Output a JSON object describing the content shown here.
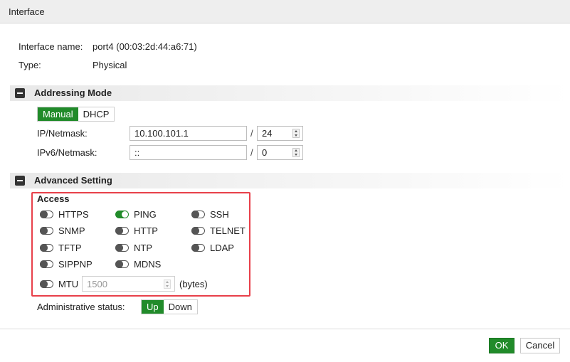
{
  "header": {
    "title": "Interface"
  },
  "info": {
    "interface_name_label": "Interface name:",
    "interface_name_value": "port4 (00:03:2d:44:a6:71)",
    "type_label": "Type:",
    "type_value": "Physical"
  },
  "addressing": {
    "section_title": "Addressing Mode",
    "mode_options": [
      "Manual",
      "DHCP"
    ],
    "selected_mode": "Manual",
    "ip_label": "IP/Netmask:",
    "ip_value": "10.100.101.1",
    "netmask_value": "24",
    "ipv6_label": "IPv6/Netmask:",
    "ipv6_value": "::",
    "ipv6_netmask_value": "0",
    "separator": "/"
  },
  "advanced": {
    "section_title": "Advanced Setting",
    "access_title": "Access",
    "access": [
      {
        "label": "HTTPS",
        "enabled": false
      },
      {
        "label": "PING",
        "enabled": true
      },
      {
        "label": "SSH",
        "enabled": false
      },
      {
        "label": "SNMP",
        "enabled": false
      },
      {
        "label": "HTTP",
        "enabled": false
      },
      {
        "label": "TELNET",
        "enabled": false
      },
      {
        "label": "TFTP",
        "enabled": false
      },
      {
        "label": "NTP",
        "enabled": false
      },
      {
        "label": "LDAP",
        "enabled": false
      },
      {
        "label": "SIPPNP",
        "enabled": false
      },
      {
        "label": "MDNS",
        "enabled": false
      }
    ],
    "mtu": {
      "label": "MTU",
      "enabled": false,
      "value": "1500",
      "unit": "(bytes)"
    },
    "admin_status_label": "Administrative status:",
    "admin_status_options": [
      "Up",
      "Down"
    ],
    "admin_status_selected": "Up"
  },
  "footer": {
    "ok_label": "OK",
    "cancel_label": "Cancel"
  },
  "colors": {
    "accent": "#218b2a",
    "highlight_border": "#e8404a",
    "header_bg": "#eeeeee"
  }
}
